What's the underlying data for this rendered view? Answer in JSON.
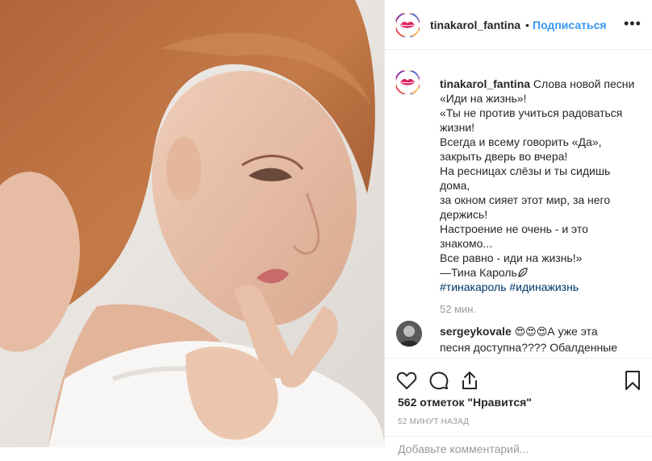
{
  "post": {
    "image_alt": "Portrait photo",
    "author": "tinakarol_fantina",
    "follow_dot": "•",
    "follow_label": "Подписаться",
    "more_label": "•••"
  },
  "caption": {
    "user": "tinakarol_fantina",
    "lines": [
      "Слова новой песни",
      "«Иди на жизнь»!",
      "«Ты не против учиться радоваться",
      "жизни!",
      "Всегда и всему говорить «Да»,",
      "закрыть дверь во вчера!",
      "На ресницах слёзы и ты сидишь",
      "дома,",
      "за окном сияет этот мир, за него",
      "держись!",
      "Настроение не очень - и это",
      "знакомо...",
      "Все равно - иди на жизнь!»",
      "—Тина Кароль"
    ],
    "tags": "#тинакароль #идинажизнь",
    "time": "52 мин."
  },
  "comment": {
    "user": "sergeykovale",
    "emoji": "😍😍😍",
    "text_line1": "А уже эта",
    "text_line2": "песня доступна???? Обалденные"
  },
  "actions": {
    "likes": "562 отметок \"Нравится\"",
    "time_ago": "52 минут назад",
    "add_comment_placeholder": "Добавьте комментарий..."
  },
  "icons": {
    "like": "heart-icon",
    "comment": "comment-icon",
    "share": "share-icon",
    "save": "bookmark-icon",
    "more": "more-icon"
  },
  "colors": {
    "link_blue": "#3897f0",
    "hashtag": "#003569",
    "muted": "#999999",
    "lips": "#e0245e"
  }
}
